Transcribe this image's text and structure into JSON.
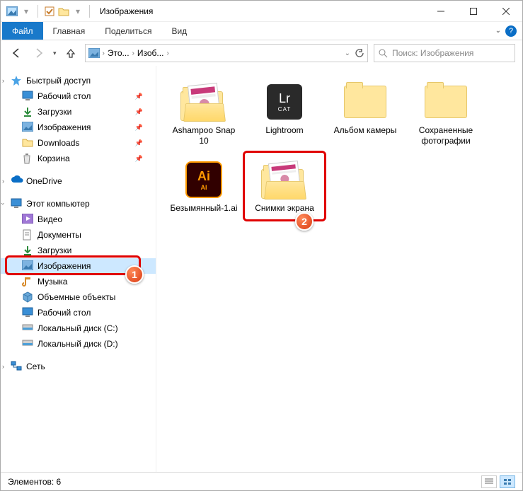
{
  "window": {
    "title": "Изображения"
  },
  "ribbon": {
    "file": "Файл",
    "tabs": [
      "Главная",
      "Поделиться",
      "Вид"
    ]
  },
  "address": {
    "segs": [
      "Это...",
      "Изоб..."
    ]
  },
  "search": {
    "placeholder": "Поиск: Изображения"
  },
  "sidebar": {
    "quick": {
      "label": "Быстрый доступ",
      "items": [
        {
          "label": "Рабочий стол",
          "pinned": true
        },
        {
          "label": "Загрузки",
          "pinned": true
        },
        {
          "label": "Изображения",
          "pinned": true
        },
        {
          "label": "Downloads",
          "pinned": true
        },
        {
          "label": "Корзина",
          "pinned": true
        }
      ]
    },
    "onedrive": {
      "label": "OneDrive"
    },
    "thispc": {
      "label": "Этот компьютер",
      "items": [
        {
          "label": "Видео"
        },
        {
          "label": "Документы"
        },
        {
          "label": "Загрузки"
        },
        {
          "label": "Изображения"
        },
        {
          "label": "Музыка"
        },
        {
          "label": "Объемные объекты"
        },
        {
          "label": "Рабочий стол"
        },
        {
          "label": "Локальный диск (C:)"
        },
        {
          "label": "Локальный диск (D:)"
        }
      ]
    },
    "network": {
      "label": "Сеть"
    }
  },
  "items": [
    {
      "label": "Ashampoo Snap 10"
    },
    {
      "label": "Lightroom"
    },
    {
      "label": "Альбом камеры"
    },
    {
      "label": "Сохраненные фотографии"
    },
    {
      "label": "Безымянный-1.ai"
    },
    {
      "label": "Снимки экрана"
    }
  ],
  "ai_tile": {
    "top": "Ai",
    "bottom": "AI"
  },
  "lr_tile": {
    "top": "Lr",
    "bottom": "CAT"
  },
  "status": {
    "count": "Элементов: 6"
  },
  "annotations": {
    "a1": "1",
    "a2": "2"
  }
}
